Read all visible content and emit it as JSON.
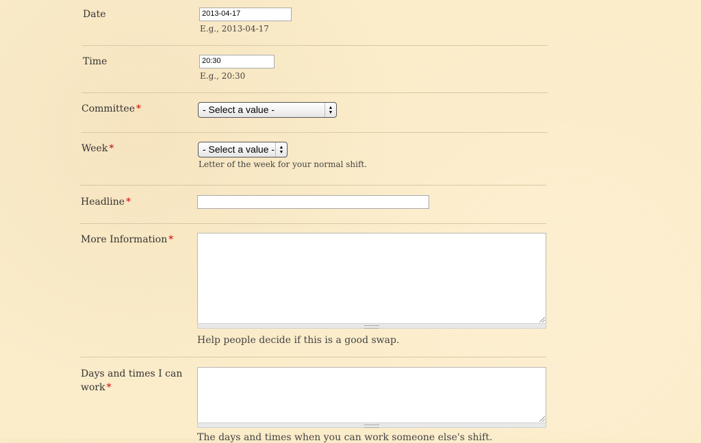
{
  "form": {
    "date": {
      "label": "Date",
      "value": "2013-04-17",
      "description": "E.g., 2013-04-17"
    },
    "time": {
      "label": "Time",
      "value": "20:30",
      "description": "E.g., 20:30"
    },
    "committee": {
      "label": "Committee",
      "required_mark": "*",
      "selected": "- Select a value -"
    },
    "week": {
      "label": "Week",
      "required_mark": "*",
      "selected": "- Select a value -",
      "description": "Letter of the week for your normal shift."
    },
    "headline": {
      "label": "Headline",
      "required_mark": "*",
      "value": ""
    },
    "more_info": {
      "label": "More Information",
      "required_mark": "*",
      "value": "",
      "description": "Help people decide if this is a good swap."
    },
    "days_times": {
      "label_line1": "Days and times I can",
      "label_line2": "work",
      "required_mark": "*",
      "value": "",
      "description": "The days and times when you can work someone else's shift."
    }
  },
  "colors": {
    "background": "#fbecca",
    "required": "#cc0000",
    "divider": "#d9c8a2"
  },
  "icons": {
    "select_arrows": "updown-arrows-icon",
    "resize": "resize-grip-icon"
  }
}
